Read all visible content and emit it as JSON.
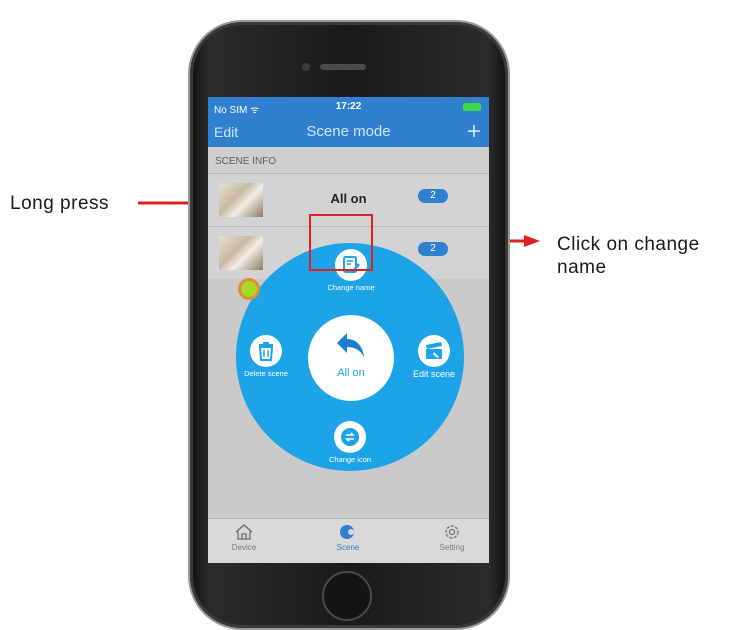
{
  "annotations": {
    "long_press": "Long press",
    "click_on_change_name": "Click on change\nname"
  },
  "status_bar": {
    "carrier": "No SIM",
    "time": "17:22"
  },
  "nav": {
    "edit_label": "Edit",
    "title": "Scene mode",
    "add_symbol": "+"
  },
  "section_header": "SCENE INFO",
  "scenes": [
    {
      "label": "All on",
      "count": "2"
    },
    {
      "label": "",
      "count": "2"
    }
  ],
  "circle_menu": {
    "center_label": "All on",
    "change_name": "Change name",
    "delete_scene": "Delete scene",
    "edit_scene": "Edit scene",
    "change_icon": "Change icon"
  },
  "tabs": [
    {
      "label": "Device",
      "icon": "home-icon"
    },
    {
      "label": "Scene",
      "icon": "scene-icon",
      "active": true
    },
    {
      "label": "Setting",
      "icon": "gear-icon"
    }
  ],
  "colors": {
    "accent": "#2f80ce",
    "menu": "#1da4e8",
    "highlight": "#e02020"
  }
}
